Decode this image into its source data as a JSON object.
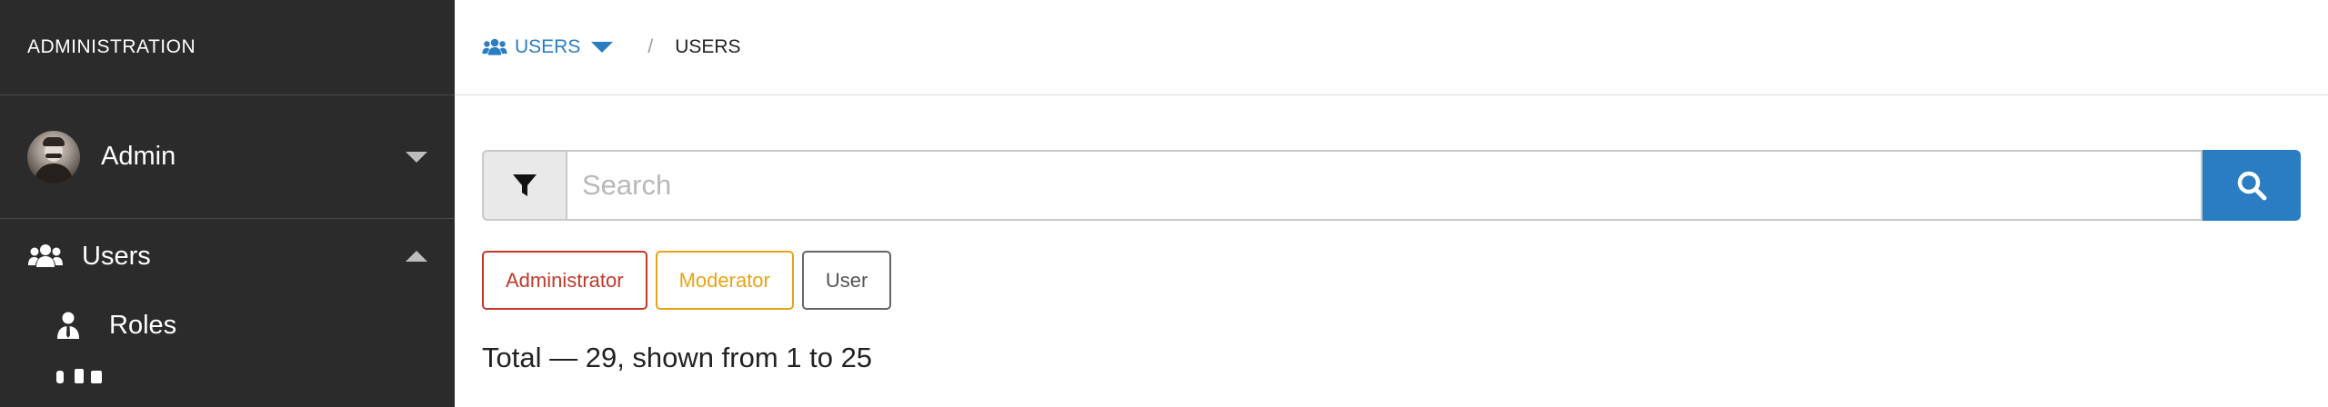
{
  "sidebar": {
    "title": "ADMINISTRATION",
    "user": {
      "name": "Admin"
    },
    "items": [
      {
        "label": "Users",
        "icon": "users-icon"
      },
      {
        "label": "Roles",
        "icon": "user-tie-icon"
      }
    ]
  },
  "breadcrumb": {
    "section": "USERS",
    "current": "USERS",
    "separator": "/"
  },
  "search": {
    "placeholder": "Search"
  },
  "role_filters": [
    {
      "label": "Administrator",
      "color": "#c0392b"
    },
    {
      "label": "Moderator",
      "color": "#e8a317"
    },
    {
      "label": "User",
      "color": "#555555"
    }
  ],
  "summary": {
    "total_text": "Total — 29, shown from 1 to 25"
  },
  "colors": {
    "sidebar_bg": "#2b2b2b",
    "accent": "#2a7dc2"
  }
}
